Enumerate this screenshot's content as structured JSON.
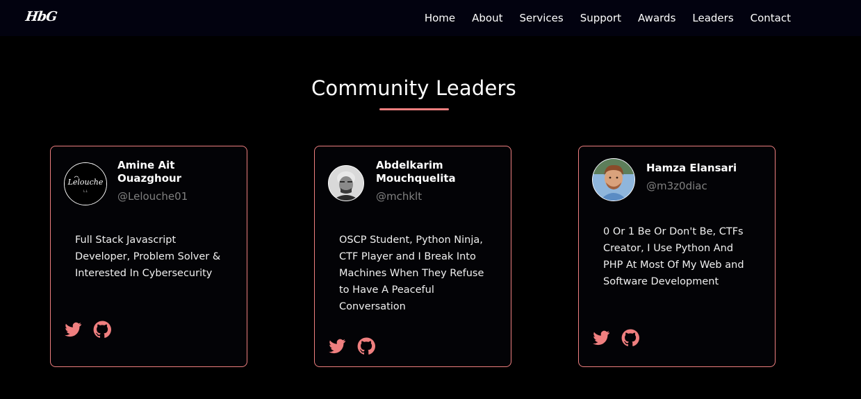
{
  "nav": {
    "logo": "HbG",
    "links": [
      "Home",
      "About",
      "Services",
      "Support",
      "Awards",
      "Leaders",
      "Contact"
    ]
  },
  "section": {
    "title": "Community Leaders"
  },
  "leaders": [
    {
      "name": "Amine Ait Ouazghour",
      "handle": "@Lelouche01",
      "bio": "Full Stack Javascript Developer, Problem Solver & Interested In Cybersecurity",
      "avatar_text": "Lelouche",
      "avatar_subtext": "L.L"
    },
    {
      "name": "Abdelkarim Mouchquelita",
      "handle": "@mchklt",
      "bio": "OSCP Student, Python Ninja, CTF Player and I Break Into Machines When They Refuse to Have A Peaceful Conversation"
    },
    {
      "name": "Hamza Elansari",
      "handle": "@m3z0diac",
      "bio": "0 Or 1 Be Or Don't Be, CTFs Creator, I Use Python And PHP At Most Of My Web and Software Development"
    }
  ],
  "icons": {
    "twitter": "twitter-icon",
    "github": "github-icon"
  },
  "colors": {
    "accent": "#ef7f7f",
    "background": "#000000",
    "navbar": "#02020f",
    "handle": "#808080"
  }
}
